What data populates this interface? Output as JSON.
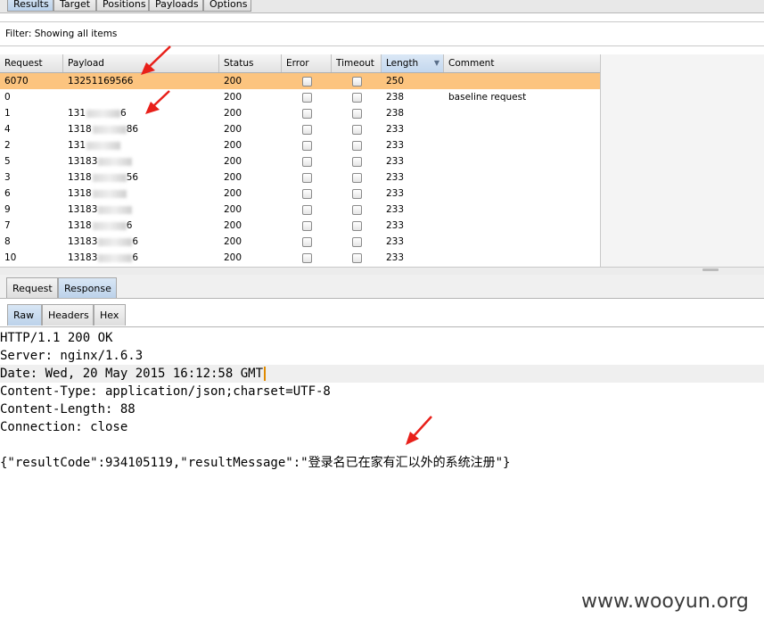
{
  "top_tabs": [
    "Results",
    "Target",
    "Positions",
    "Payloads",
    "Options"
  ],
  "filter": "Filter: Showing all items",
  "columns": [
    "Request",
    "Payload",
    "Status",
    "Error",
    "Timeout",
    "Length",
    "Comment"
  ],
  "sorted_column_icon": "sort-down-icon",
  "rows": [
    {
      "request": "6070",
      "payload_a": "13251169566",
      "payload_b": "",
      "status": "200",
      "length": "250",
      "comment": ""
    },
    {
      "request": "0",
      "payload_a": "",
      "payload_b": "",
      "status": "200",
      "length": "238",
      "comment": "baseline request"
    },
    {
      "request": "1",
      "payload_a": "131",
      "payload_b": "6",
      "status": "200",
      "length": "238",
      "comment": ""
    },
    {
      "request": "4",
      "payload_a": "1318",
      "payload_b": "86",
      "status": "200",
      "length": "233",
      "comment": ""
    },
    {
      "request": "2",
      "payload_a": "131",
      "payload_b": "",
      "status": "200",
      "length": "233",
      "comment": ""
    },
    {
      "request": "5",
      "payload_a": "13183",
      "payload_b": "",
      "status": "200",
      "length": "233",
      "comment": ""
    },
    {
      "request": "3",
      "payload_a": "1318",
      "payload_b": "56",
      "status": "200",
      "length": "233",
      "comment": ""
    },
    {
      "request": "6",
      "payload_a": "1318",
      "payload_b": "",
      "status": "200",
      "length": "233",
      "comment": ""
    },
    {
      "request": "9",
      "payload_a": "13183",
      "payload_b": "",
      "status": "200",
      "length": "233",
      "comment": ""
    },
    {
      "request": "7",
      "payload_a": "1318",
      "payload_b": "6",
      "status": "200",
      "length": "233",
      "comment": ""
    },
    {
      "request": "8",
      "payload_a": "13183",
      "payload_b": "6",
      "status": "200",
      "length": "233",
      "comment": ""
    },
    {
      "request": "10",
      "payload_a": "13183",
      "payload_b": "6",
      "status": "200",
      "length": "233",
      "comment": ""
    }
  ],
  "req_resp_tabs": [
    "Request",
    "Response"
  ],
  "view_tabs": [
    "Raw",
    "Headers",
    "Hex"
  ],
  "response_lines": [
    "HTTP/1.1 200 OK",
    "Server: nginx/1.6.3",
    "Date: Wed, 20 May 2015 16:12:58 GMT",
    "Content-Type: application/json;charset=UTF-8",
    "Content-Length: 88",
    "Connection: close",
    "",
    "{\"resultCode\":934105119,\"resultMessage\":\"登录名已在家有汇以外的系统注册\"}"
  ],
  "watermark": "www.wooyun.org",
  "colors": {
    "selected_row": "#fcc47f",
    "arrow": "#e8201a",
    "caret": "#e08a00"
  }
}
